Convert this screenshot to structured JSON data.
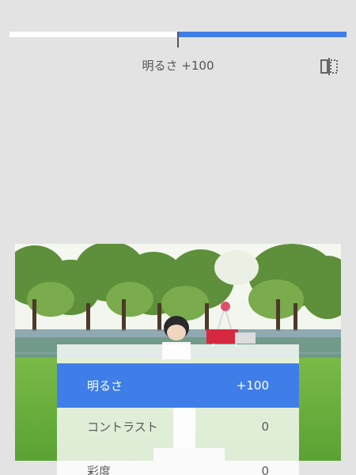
{
  "adjustment": {
    "label": "明るさ",
    "value": 100,
    "value_text": "+100",
    "readout": "明るさ +100",
    "range": [
      -100,
      100
    ]
  },
  "compare": {
    "icon": "compare-icon"
  },
  "menu": {
    "items": [
      {
        "label": "明るさ",
        "value": "+100",
        "selected": true
      },
      {
        "label": "コントラスト",
        "value": "0",
        "selected": false
      },
      {
        "label": "彩度",
        "value": "0",
        "selected": false
      }
    ]
  },
  "colors": {
    "accent": "#3f7ee8",
    "background": "#e3e3e3",
    "track": "#ffffff",
    "text": "#555555"
  }
}
